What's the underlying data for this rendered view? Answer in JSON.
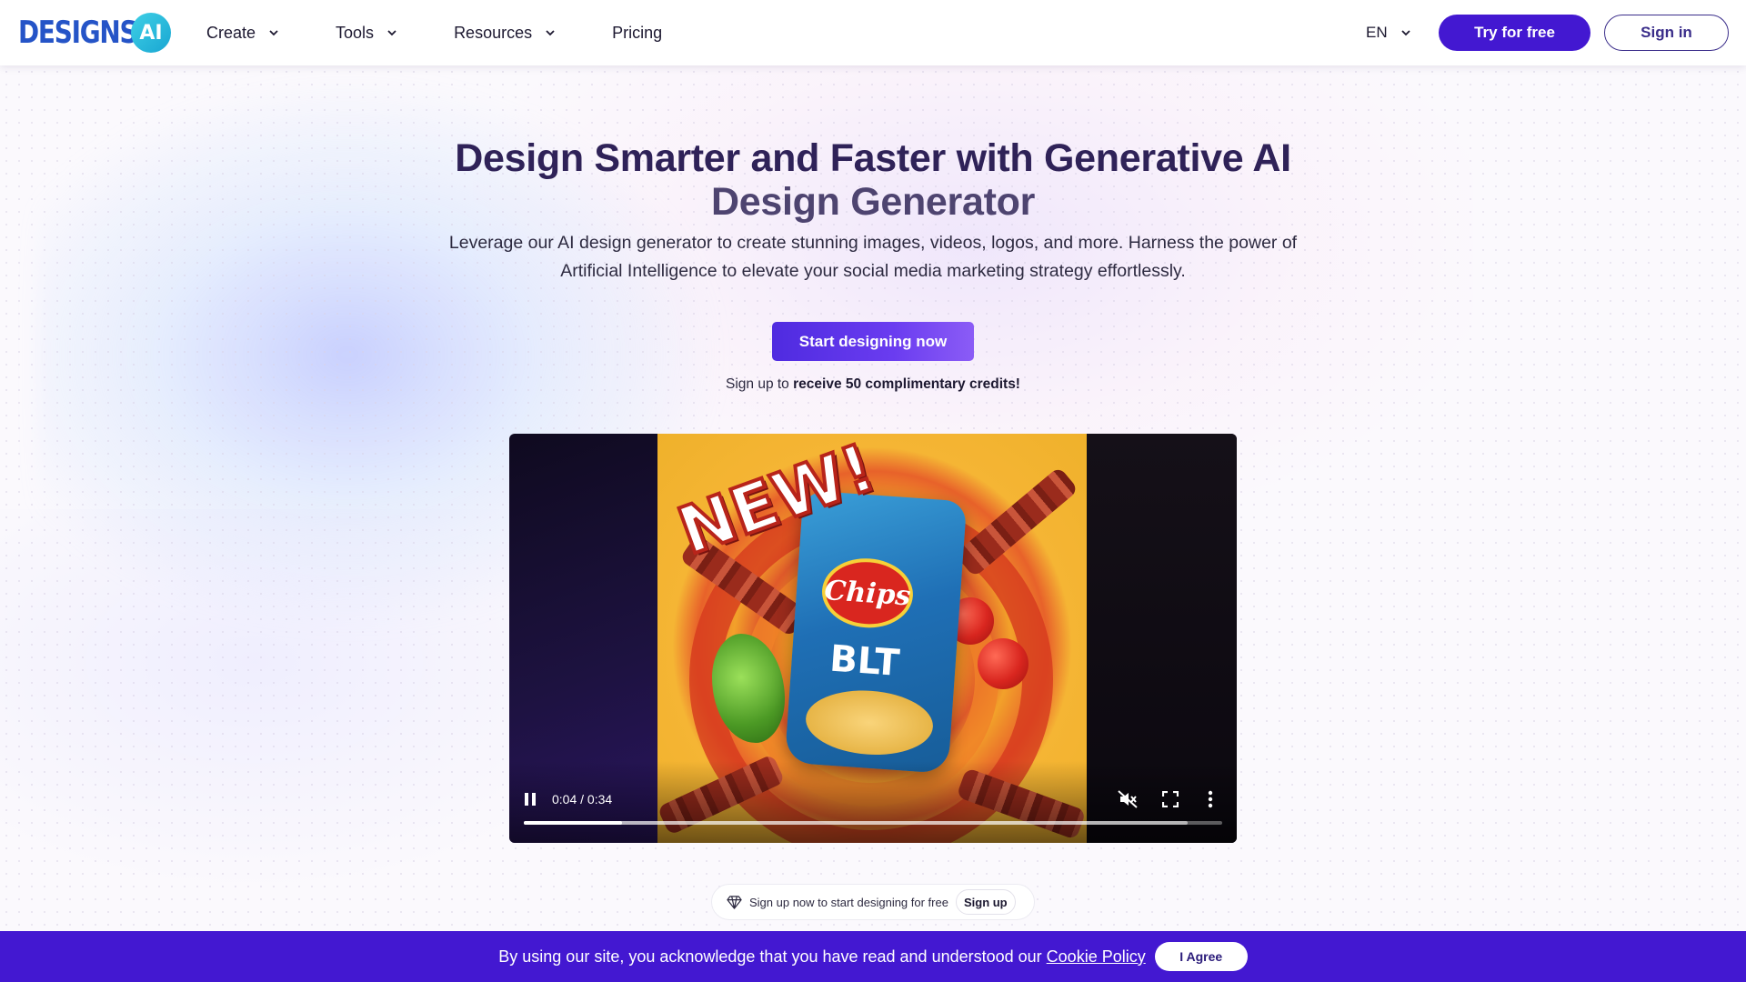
{
  "header": {
    "logo_text": "DESIGNS.",
    "logo_badge": "AI",
    "nav": [
      {
        "label": "Create",
        "has_dropdown": true
      },
      {
        "label": "Tools",
        "has_dropdown": true
      },
      {
        "label": "Resources",
        "has_dropdown": true
      },
      {
        "label": "Pricing",
        "has_dropdown": false
      }
    ],
    "language": "EN",
    "try_label": "Try for free",
    "signin_label": "Sign in"
  },
  "hero": {
    "title_line1": "Design Smarter and Faster with Generative AI",
    "title_line2": "Design Generator",
    "subtitle": "Leverage our AI design generator to create stunning images, videos, logos, and more. Harness the power of Artificial Intelligence to elevate your social media marketing strategy effortlessly.",
    "cta_label": "Start designing now",
    "credits_prefix": "Sign up to",
    "credits_bold": "receive 50 complimentary credits!"
  },
  "video": {
    "poster": {
      "new_badge": "NEW!",
      "brand": "Chips",
      "flavor": "BLT"
    },
    "time": "0:04 / 0:34",
    "progress": 0.14,
    "icons": {
      "pause": "pause-icon",
      "mute": "volume-muted-icon",
      "fullscreen": "fullscreen-icon",
      "more": "more-vertical-icon"
    }
  },
  "signup_pill": {
    "text": "Sign up now to start designing for free",
    "button": "Sign up",
    "icon": "diamond-icon"
  },
  "cookie": {
    "text": "By using our site, you acknowledge that you have read and understood our",
    "link": "Cookie Policy",
    "button": "I Agree"
  },
  "colors": {
    "brand_primary": "#4318d1",
    "logo_blue": "#2554c7",
    "logo_cyan": "#19a6d2",
    "title": "#2f2258"
  }
}
